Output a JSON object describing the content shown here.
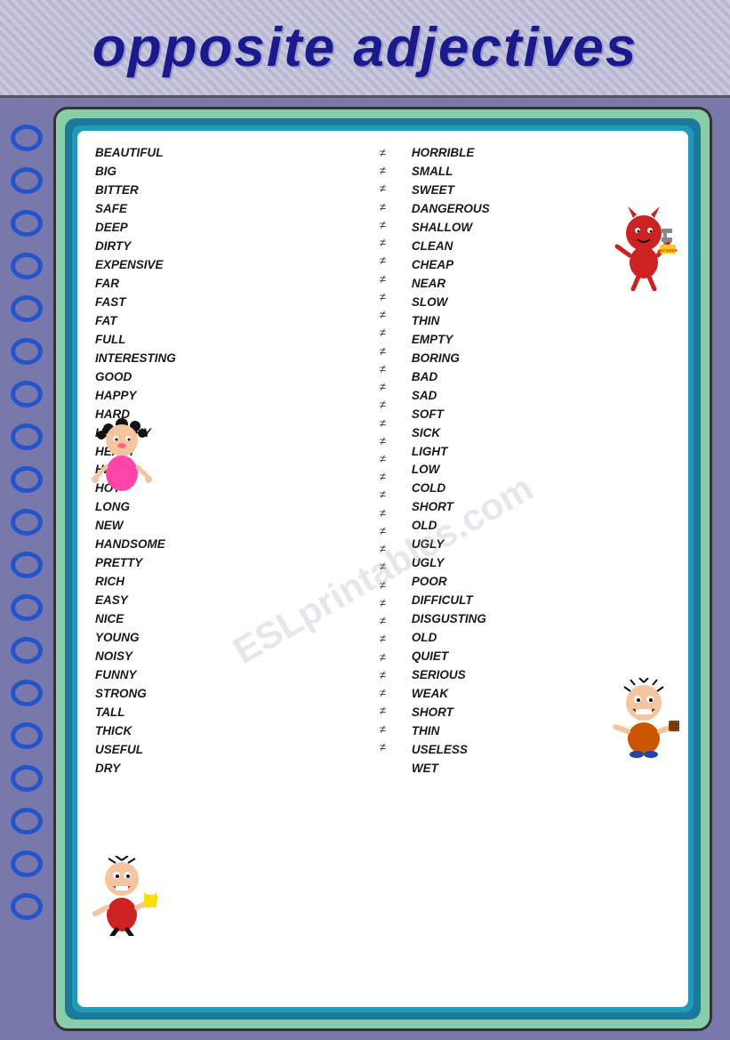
{
  "header": {
    "title": "opposite adjectives"
  },
  "pairs": [
    {
      "left": "BEAUTIFUL",
      "right": "HORRIBLE"
    },
    {
      "left": "BIG",
      "right": "SMALL"
    },
    {
      "left": "BITTER",
      "right": "SWEET"
    },
    {
      "left": "SAFE",
      "right": "DANGEROUS"
    },
    {
      "left": "DEEP",
      "right": "SHALLOW"
    },
    {
      "left": "DIRTY",
      "right": "CLEAN"
    },
    {
      "left": "EXPENSIVE",
      "right": "CHEAP"
    },
    {
      "left": "FAR",
      "right": "NEAR"
    },
    {
      "left": "FAST",
      "right": "SLOW"
    },
    {
      "left": "FAT",
      "right": "THIN"
    },
    {
      "left": "FULL",
      "right": "EMPTY"
    },
    {
      "left": "INTERESTING",
      "right": "BORING"
    },
    {
      "left": "GOOD",
      "right": "BAD"
    },
    {
      "left": "HAPPY",
      "right": "SAD"
    },
    {
      "left": "HARD",
      "right": "SOFT"
    },
    {
      "left": "HEALTHY",
      "right": "SICK"
    },
    {
      "left": "HEAVY",
      "right": "LIGHT"
    },
    {
      "left": "HIGH",
      "right": "LOW"
    },
    {
      "left": "HOT",
      "right": "COLD"
    },
    {
      "left": "LONG",
      "right": "SHORT"
    },
    {
      "left": "NEW",
      "right": "OLD"
    },
    {
      "left": "HANDSOME",
      "right": "UGLY"
    },
    {
      "left": "PRETTY",
      "right": "UGLY"
    },
    {
      "left": "RICH",
      "right": "POOR"
    },
    {
      "left": "EASY",
      "right": "DIFFICULT"
    },
    {
      "left": "NICE",
      "right": "DISGUSTING"
    },
    {
      "left": "YOUNG",
      "right": "OLD"
    },
    {
      "left": "NOISY",
      "right": "QUIET"
    },
    {
      "left": "FUNNY",
      "right": "SERIOUS"
    },
    {
      "left": "STRONG",
      "right": "WEAK"
    },
    {
      "left": "TALL",
      "right": "SHORT"
    },
    {
      "left": "THICK",
      "right": "THIN"
    },
    {
      "left": "USEFUL",
      "right": "USELESS"
    },
    {
      "left": "DRY",
      "right": "WET"
    }
  ],
  "symbol": "≠",
  "watermark": "ESLprintables.com"
}
